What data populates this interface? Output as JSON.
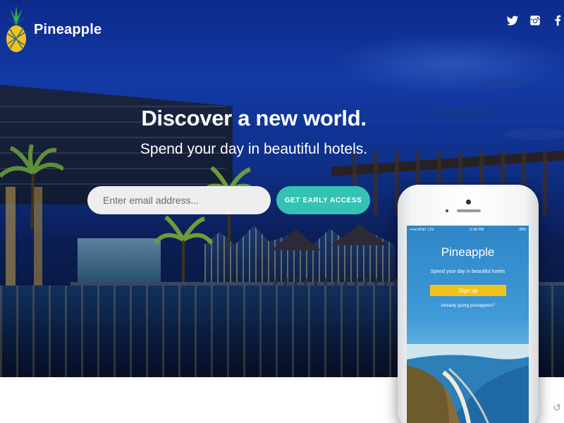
{
  "brand": {
    "name": "Pineapple",
    "logo_icon": "pineapple-logo-icon",
    "logo_colors": {
      "leaves": "#3aa84a",
      "fruit": "#f2c21c"
    }
  },
  "social": [
    {
      "name": "twitter",
      "icon": "twitter-icon"
    },
    {
      "name": "instagram",
      "icon": "instagram-icon"
    },
    {
      "name": "facebook",
      "icon": "facebook-icon"
    }
  ],
  "hero": {
    "headline": "Discover a new world.",
    "subheadline": "Spend your day in beautiful hotels.",
    "email_placeholder": "Enter email address...",
    "cta_label": "GET EARLY ACCESS"
  },
  "phone": {
    "status_left": "•••oo AT&T LTE",
    "status_time": "11:56 PM",
    "status_right": "39%",
    "app_title": "Pineapple",
    "app_tagline": "Spend your day in beautiful hotels",
    "signup_label": "Sign up",
    "login_text": "Already going pineapples?"
  },
  "colors": {
    "accent": "#34c2b4",
    "signup_yellow": "#f2c21c",
    "hero_blue": "#123aa6"
  }
}
